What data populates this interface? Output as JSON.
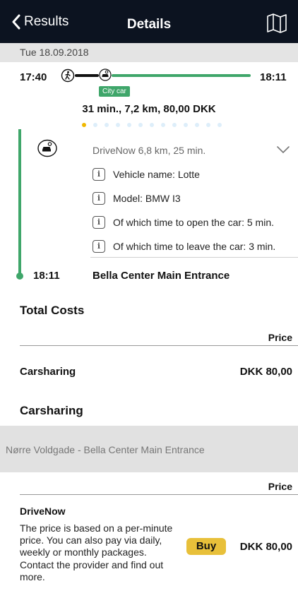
{
  "nav": {
    "back_label": "Results",
    "title": "Details"
  },
  "date": "Tue 18.09.2018",
  "trip": {
    "start_time": "17:40",
    "end_time": "18:11",
    "mode_chip": "City car",
    "summary": "31 min.,  7,2 km,  80,00 DKK",
    "page_dots": 13,
    "active_dot": 0
  },
  "leg": {
    "title": "DriveNow 6,8 km, 25 min.",
    "details": [
      "Vehicle name: Lotte",
      "Model: BMW I3",
      "Of which time to open the car: 5 min.",
      "Of which time to leave the car: 3 min."
    ],
    "arrival_time": "18:11",
    "arrival_place": "Bella Center Main Entrance"
  },
  "total_costs": {
    "heading": "Total Costs",
    "price_header": "Price",
    "rows": [
      {
        "label": "Carsharing",
        "price": "DKK 80,00"
      }
    ]
  },
  "carsharing": {
    "heading": "Carsharing",
    "route": "Nørre Voldgade - Bella Center Main Entrance",
    "price_header": "Price",
    "provider": "DriveNow",
    "description": "The price is based on a per-minute price. You can also pay via daily, weekly or monthly packages. Contact the provider and find out more.",
    "buy_label": "Buy",
    "price": "DKK 80,00"
  },
  "colors": {
    "nav_bg": "#0c1320",
    "route_green": "#3fa66a",
    "buy_yellow": "#e8c03a",
    "active_dot": "#f0b800"
  },
  "icons": {
    "back": "chevron-left-icon",
    "map": "map-icon",
    "walk": "walk-icon",
    "car": "car-icon",
    "info": "info-icon",
    "expand": "chevron-down-icon"
  }
}
